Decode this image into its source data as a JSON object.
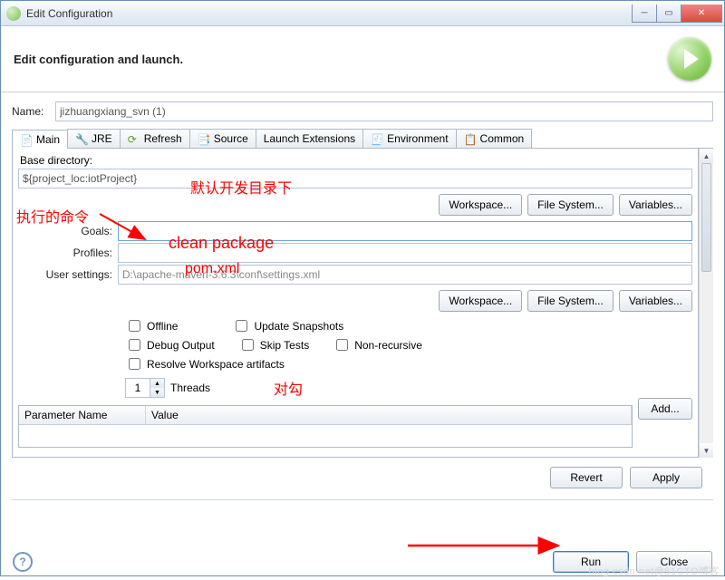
{
  "window": {
    "title": "Edit Configuration"
  },
  "header": {
    "title": "Edit configuration and launch."
  },
  "nameRow": {
    "label": "Name:",
    "value": "jizhuangxiang_svn (1)"
  },
  "tabs": {
    "main": "Main",
    "jre": "JRE",
    "refresh": "Refresh",
    "source": "Source",
    "launchExt": "Launch Extensions",
    "environment": "Environment",
    "common": "Common"
  },
  "form": {
    "baseDirLabel": "Base directory:",
    "baseDir": "${project_loc:iotProject}",
    "goalsLabel": "Goals:",
    "goals": "",
    "profilesLabel": "Profiles:",
    "profiles": "",
    "userSettingsLabel": "User settings:",
    "userSettings": "D:\\apache-maven-3.6.3\\conf\\settings.xml"
  },
  "buttons": {
    "workspace": "Workspace...",
    "filesystem": "File System...",
    "variables": "Variables...",
    "add": "Add...",
    "revert": "Revert",
    "apply": "Apply",
    "run": "Run",
    "close": "Close"
  },
  "checks": {
    "offline": "Offline",
    "updateSnapshots": "Update Snapshots",
    "debugOutput": "Debug Output",
    "skipTests": "Skip Tests",
    "nonRecursive": "Non-recursive",
    "resolveWorkspace": "Resolve Workspace artifacts"
  },
  "threads": {
    "label": "Threads",
    "value": "1"
  },
  "table": {
    "col1": "Parameter Name",
    "col2": "Value"
  },
  "annotations": {
    "defaultDir": "默认开发目录下",
    "execCmd": "执行的命令",
    "cleanPackage": "clean package",
    "pom": "pom.xml",
    "tick": "对勾"
  },
  "watermark": "blog.csdn.net@51CTO博客"
}
